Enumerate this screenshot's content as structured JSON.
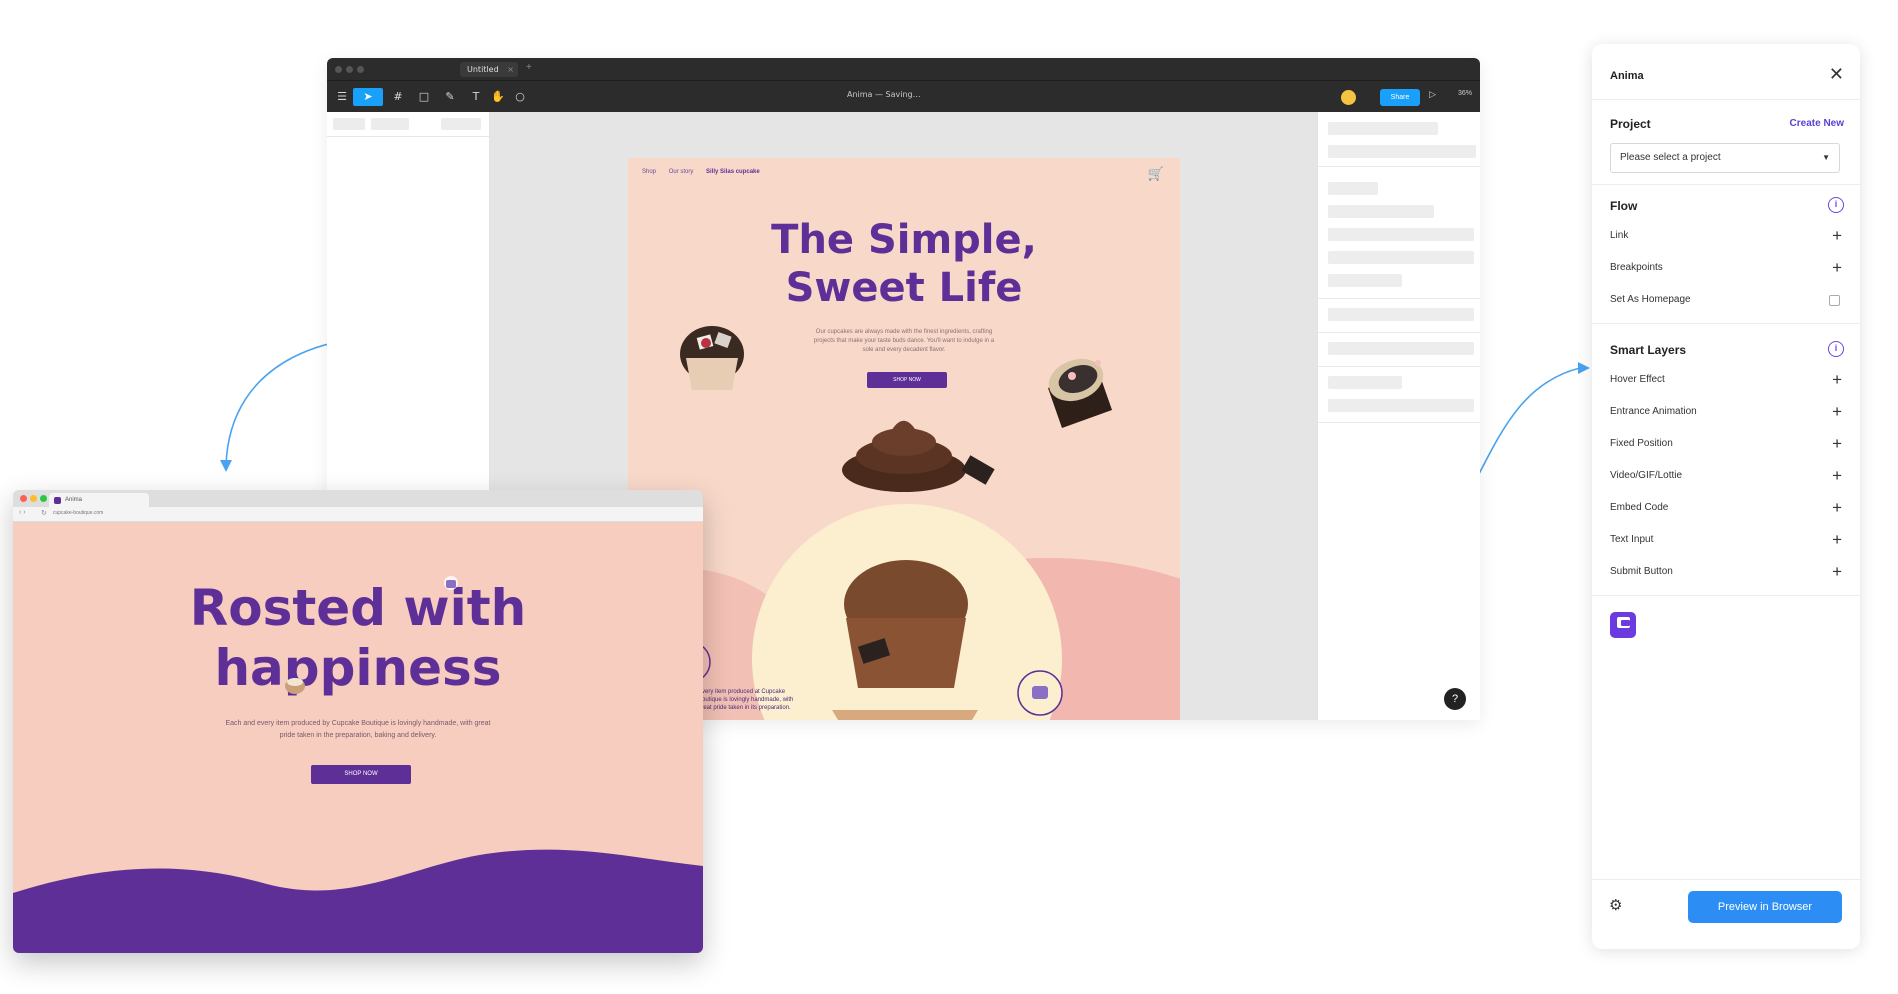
{
  "figma": {
    "tab_title": "Untitled",
    "document_label": "Anima — Saving…",
    "share_label": "Share",
    "zoom_label": "36%"
  },
  "frame": {
    "nav": [
      "Shop",
      "Our story",
      "Silly Silas cupcake"
    ],
    "title_line1": "The Simple,",
    "title_line2": "Sweet Life",
    "subtitle": "Our cupcakes are always made with the finest ingredients, crafting projects that make your taste buds dance. You'll want to indulge in a sole and every decadent flavor.",
    "button": "SHOP NOW",
    "blurb": "Every item produced at Cupcake Boutique is lovingly handmade, with great pride taken in its preparation."
  },
  "browser": {
    "tab_title": "Anima",
    "address": "cupcake-boutique.com",
    "title_line1": "Rosted with",
    "title_line2": "happiness",
    "subtitle": "Each and every item produced by Cupcake Boutique is lovingly handmade, with great pride taken in the preparation, baking and delivery.",
    "button": "SHOP NOW"
  },
  "anima": {
    "title": "Anima",
    "project": {
      "heading": "Project",
      "create_new": "Create New",
      "select_placeholder": "Please select a project"
    },
    "flow": {
      "heading": "Flow",
      "items": [
        "Link",
        "Breakpoints",
        "Set As Homepage"
      ]
    },
    "smart_layers": {
      "heading": "Smart Layers",
      "items": [
        "Hover Effect",
        "Entrance Animation",
        "Fixed Position",
        "Video/GIF/Lottie",
        "Embed Code",
        "Text Input",
        "Submit Button"
      ]
    },
    "preview_button": "Preview in Browser"
  },
  "colors": {
    "brand_purple": "#5e2f97",
    "peach": "#f8d8c9",
    "figma_blue": "#18a0fb",
    "anima_blue": "#2c8ef4",
    "anima_purple": "#6b46e0"
  }
}
